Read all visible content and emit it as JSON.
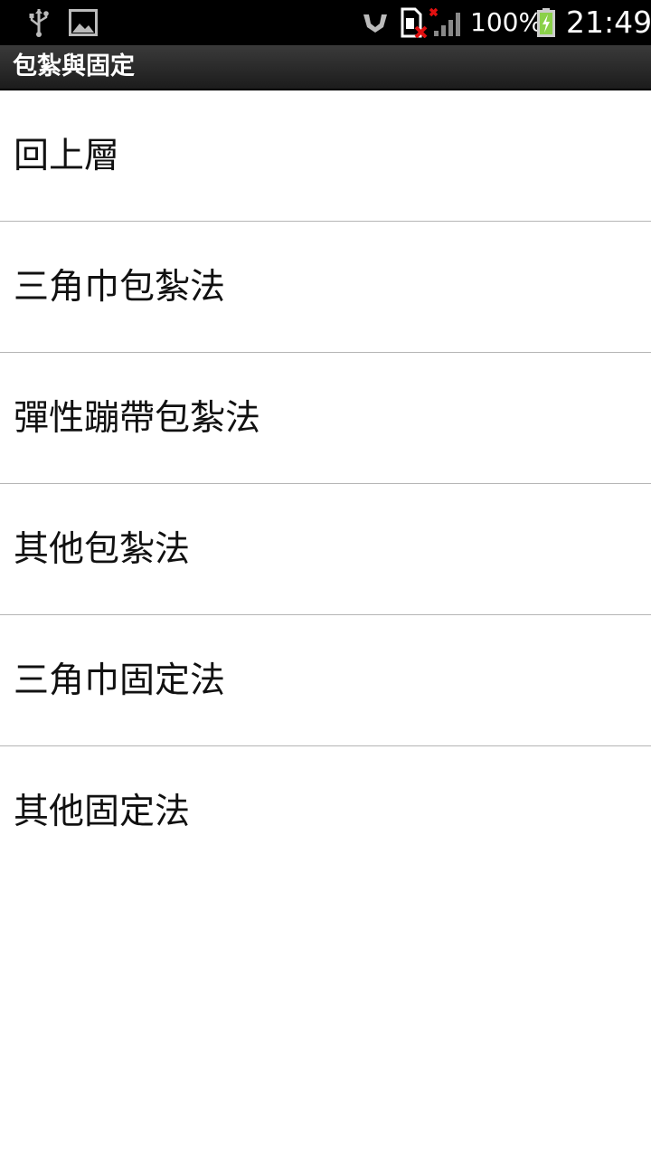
{
  "status_bar": {
    "battery_text": "100%",
    "time": "21:49",
    "icons": [
      "usb-icon",
      "image-icon",
      "vibrate-icon",
      "sim-error-icon",
      "signal-icon",
      "battery-charging-icon"
    ]
  },
  "title_bar": {
    "title": "包紮與固定"
  },
  "menu": {
    "items": [
      {
        "label": "回上層"
      },
      {
        "label": "三角巾包紮法"
      },
      {
        "label": "彈性蹦帶包紮法"
      },
      {
        "label": "其他包紮法"
      },
      {
        "label": "三角巾固定法"
      },
      {
        "label": "其他固定法"
      }
    ]
  },
  "colors": {
    "status_bar_bg": "#000000",
    "title_bar_bg": "#2a2a2a",
    "list_bg": "#ffffff",
    "divider": "#b5b5b5",
    "battery_green": "#8bd14a"
  }
}
